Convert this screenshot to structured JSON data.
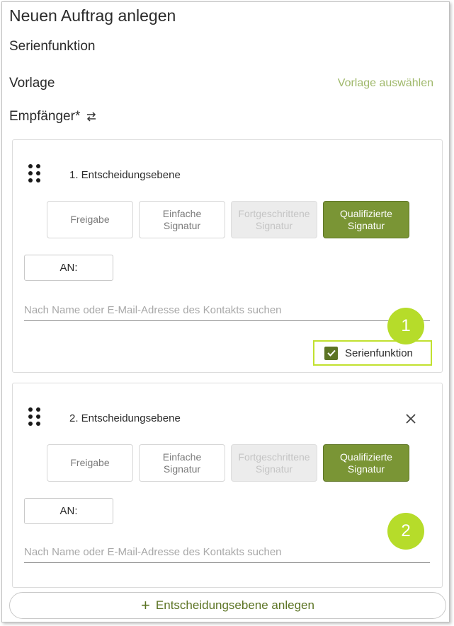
{
  "header": {
    "title": "Neuen Auftrag anlegen",
    "serienfunktion_label": "Serienfunktion",
    "vorlage_label": "Vorlage",
    "vorlage_link": "Vorlage auswählen",
    "empfaenger_label": "Empfänger*"
  },
  "levels": [
    {
      "title": "1. Entscheidungsebene",
      "signature_options": [
        "Freigabe",
        "Einfache\nSignatur",
        "Fortgeschrittene\nSignatur",
        "Qualifizierte\nSignatur"
      ],
      "selected_option": "Qualifizierte\nSignatur",
      "an_label": "AN:",
      "search_placeholder": "Nach Name oder E-Mail-Adresse des Kontakts suchen",
      "search_value": "",
      "serienfunktion_checkbox_label": "Serienfunktion",
      "serienfunktion_checked": true
    },
    {
      "title": "2. Entscheidungsebene",
      "signature_options": [
        "Freigabe",
        "Einfache\nSignatur",
        "Fortgeschrittene\nSignatur",
        "Qualifizierte\nSignatur"
      ],
      "selected_option": "Qualifizierte\nSignatur",
      "an_label": "AN:",
      "search_placeholder": "Nach Name oder E-Mail-Adresse des Kontakts suchen",
      "search_value": ""
    }
  ],
  "callouts": [
    "1",
    "2"
  ],
  "add_level_button": "Entscheidungsebene anlegen",
  "icons": {
    "drag": "drag-handle-icon",
    "close": "close-icon",
    "repeat": "repeat-icon",
    "plus": "plus-icon",
    "check": "check-icon"
  },
  "colors": {
    "accent": "#7a9535",
    "accent_dark": "#5c7424",
    "link": "#9fb86a",
    "highlight": "#c1e12f",
    "badge": "#b6dc2a"
  }
}
